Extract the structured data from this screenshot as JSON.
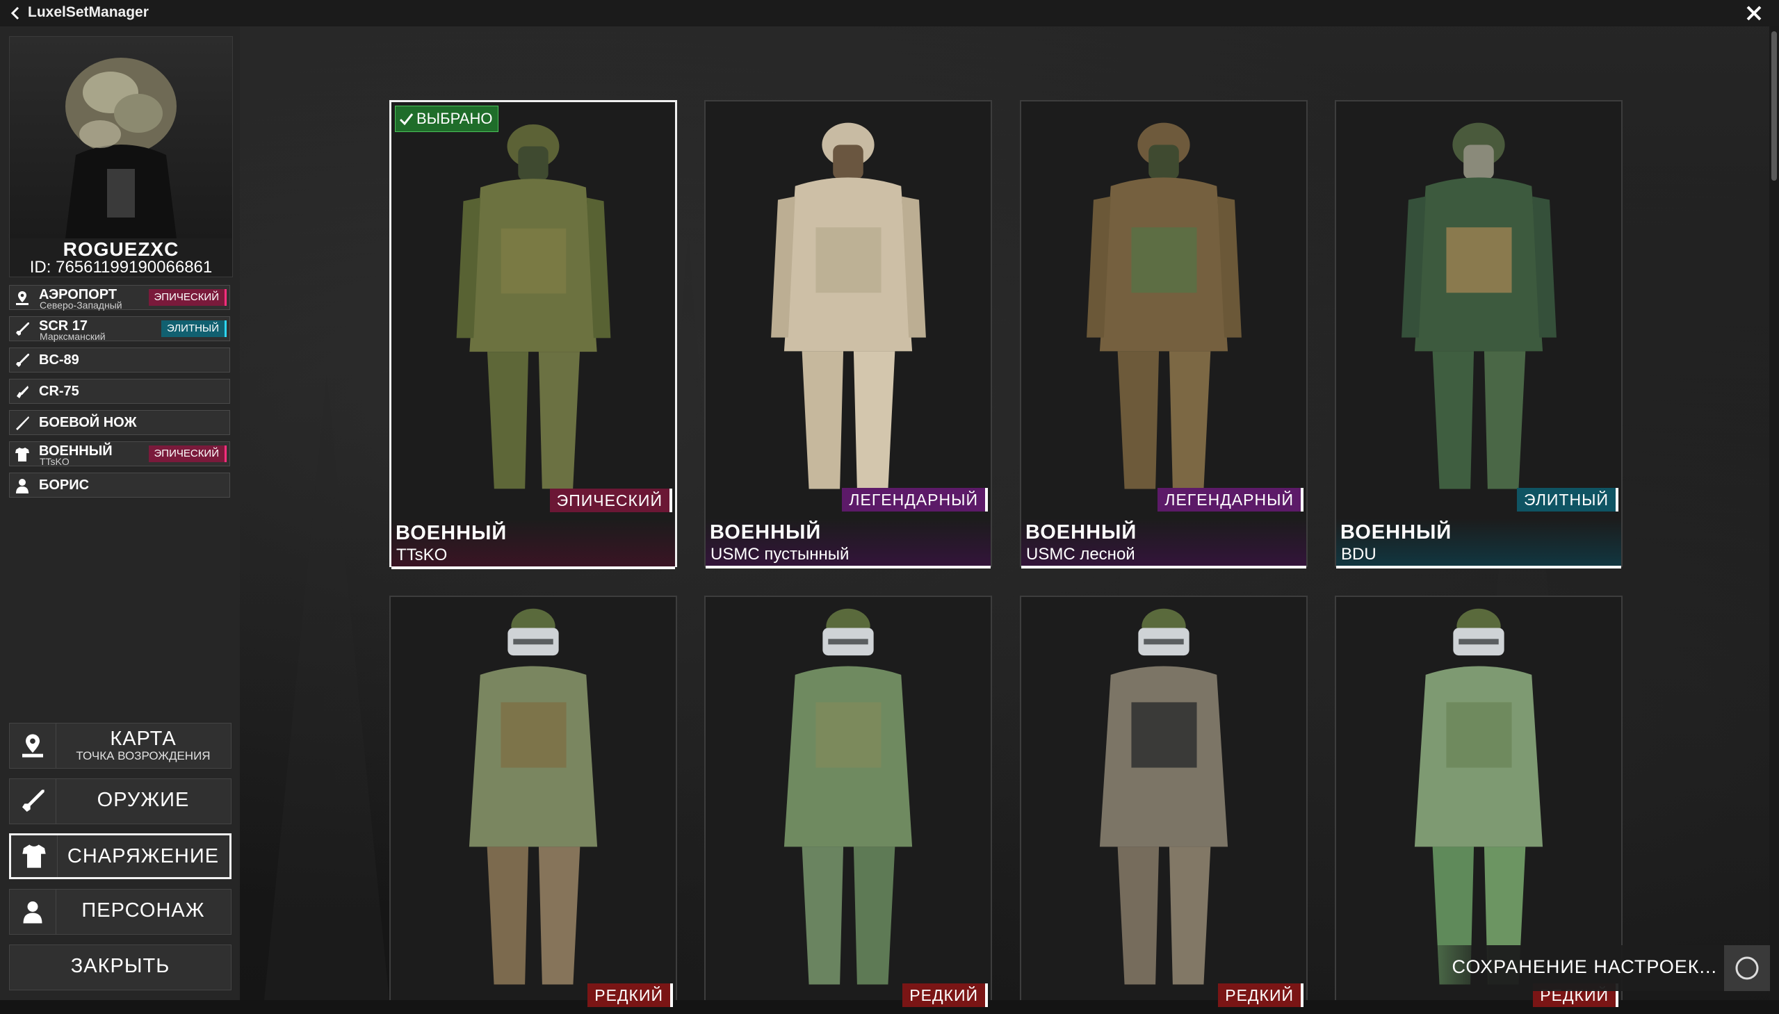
{
  "window": {
    "title": "LuxelSetManager"
  },
  "profile": {
    "username": "ROGUEZXC",
    "id_text": "ID: 76561199190066861"
  },
  "loadout": [
    {
      "name": "АЭРОПОРТ",
      "sub": "Северо-Западный",
      "badge": "ЭПИЧЕСКИЙ",
      "icon": "map-pin-icon"
    },
    {
      "name": "SCR 17",
      "sub": "Марксманский",
      "badge": "ЭЛИТНЫЙ",
      "icon": "rifle-icon"
    },
    {
      "name": "BC-89",
      "icon": "rifle-icon"
    },
    {
      "name": "CR-75",
      "icon": "pistol-icon"
    },
    {
      "name": "БОЕВОЙ НОЖ",
      "icon": "knife-icon"
    },
    {
      "name": "ВОЕННЫЙ",
      "sub": "TTsKO",
      "badge": "ЭПИЧЕСКИЙ",
      "icon": "shirt-icon"
    },
    {
      "name": "БОРИС",
      "icon": "person-icon"
    }
  ],
  "nav": {
    "map": {
      "label": "КАРТА",
      "sub": "ТОЧКА ВОЗРОЖДЕНИЯ"
    },
    "weapons": {
      "label": "ОРУЖИЕ"
    },
    "gear": {
      "label": "СНАРЯЖЕНИЕ"
    },
    "character": {
      "label": "ПЕРСОНАЖ"
    },
    "close": {
      "label": "ЗАКРЫТЬ"
    }
  },
  "selected_label": "ВЫБРАНО",
  "cards": [
    {
      "name": "ВОЕННЫЙ",
      "skin": "TTsKO",
      "rarity": "ЭПИЧЕСКИЙ",
      "selected": true
    },
    {
      "name": "ВОЕННЫЙ",
      "skin": "USMC пустынный",
      "rarity": "ЛЕГЕНДАРНЫЙ"
    },
    {
      "name": "ВОЕННЫЙ",
      "skin": "USMC лесной",
      "rarity": "ЛЕГЕНДАРНЫЙ"
    },
    {
      "name": "ВОЕННЫЙ",
      "skin": "BDU",
      "rarity": "ЭЛИТНЫЙ"
    },
    {
      "rarity": "РЕДКИЙ"
    },
    {
      "rarity": "РЕДКИЙ"
    },
    {
      "rarity": "РЕДКИЙ"
    },
    {
      "rarity": "РЕДКИЙ"
    }
  ],
  "status": {
    "saving_text": "СОХРАНЕНИЕ НАСТРОЕК..."
  },
  "colors": {
    "epic": "#ff2f7d",
    "legendary": "#d33cff",
    "elite": "#2fd6f2",
    "rare": "#ff3030",
    "selected": "#4cc15a"
  }
}
